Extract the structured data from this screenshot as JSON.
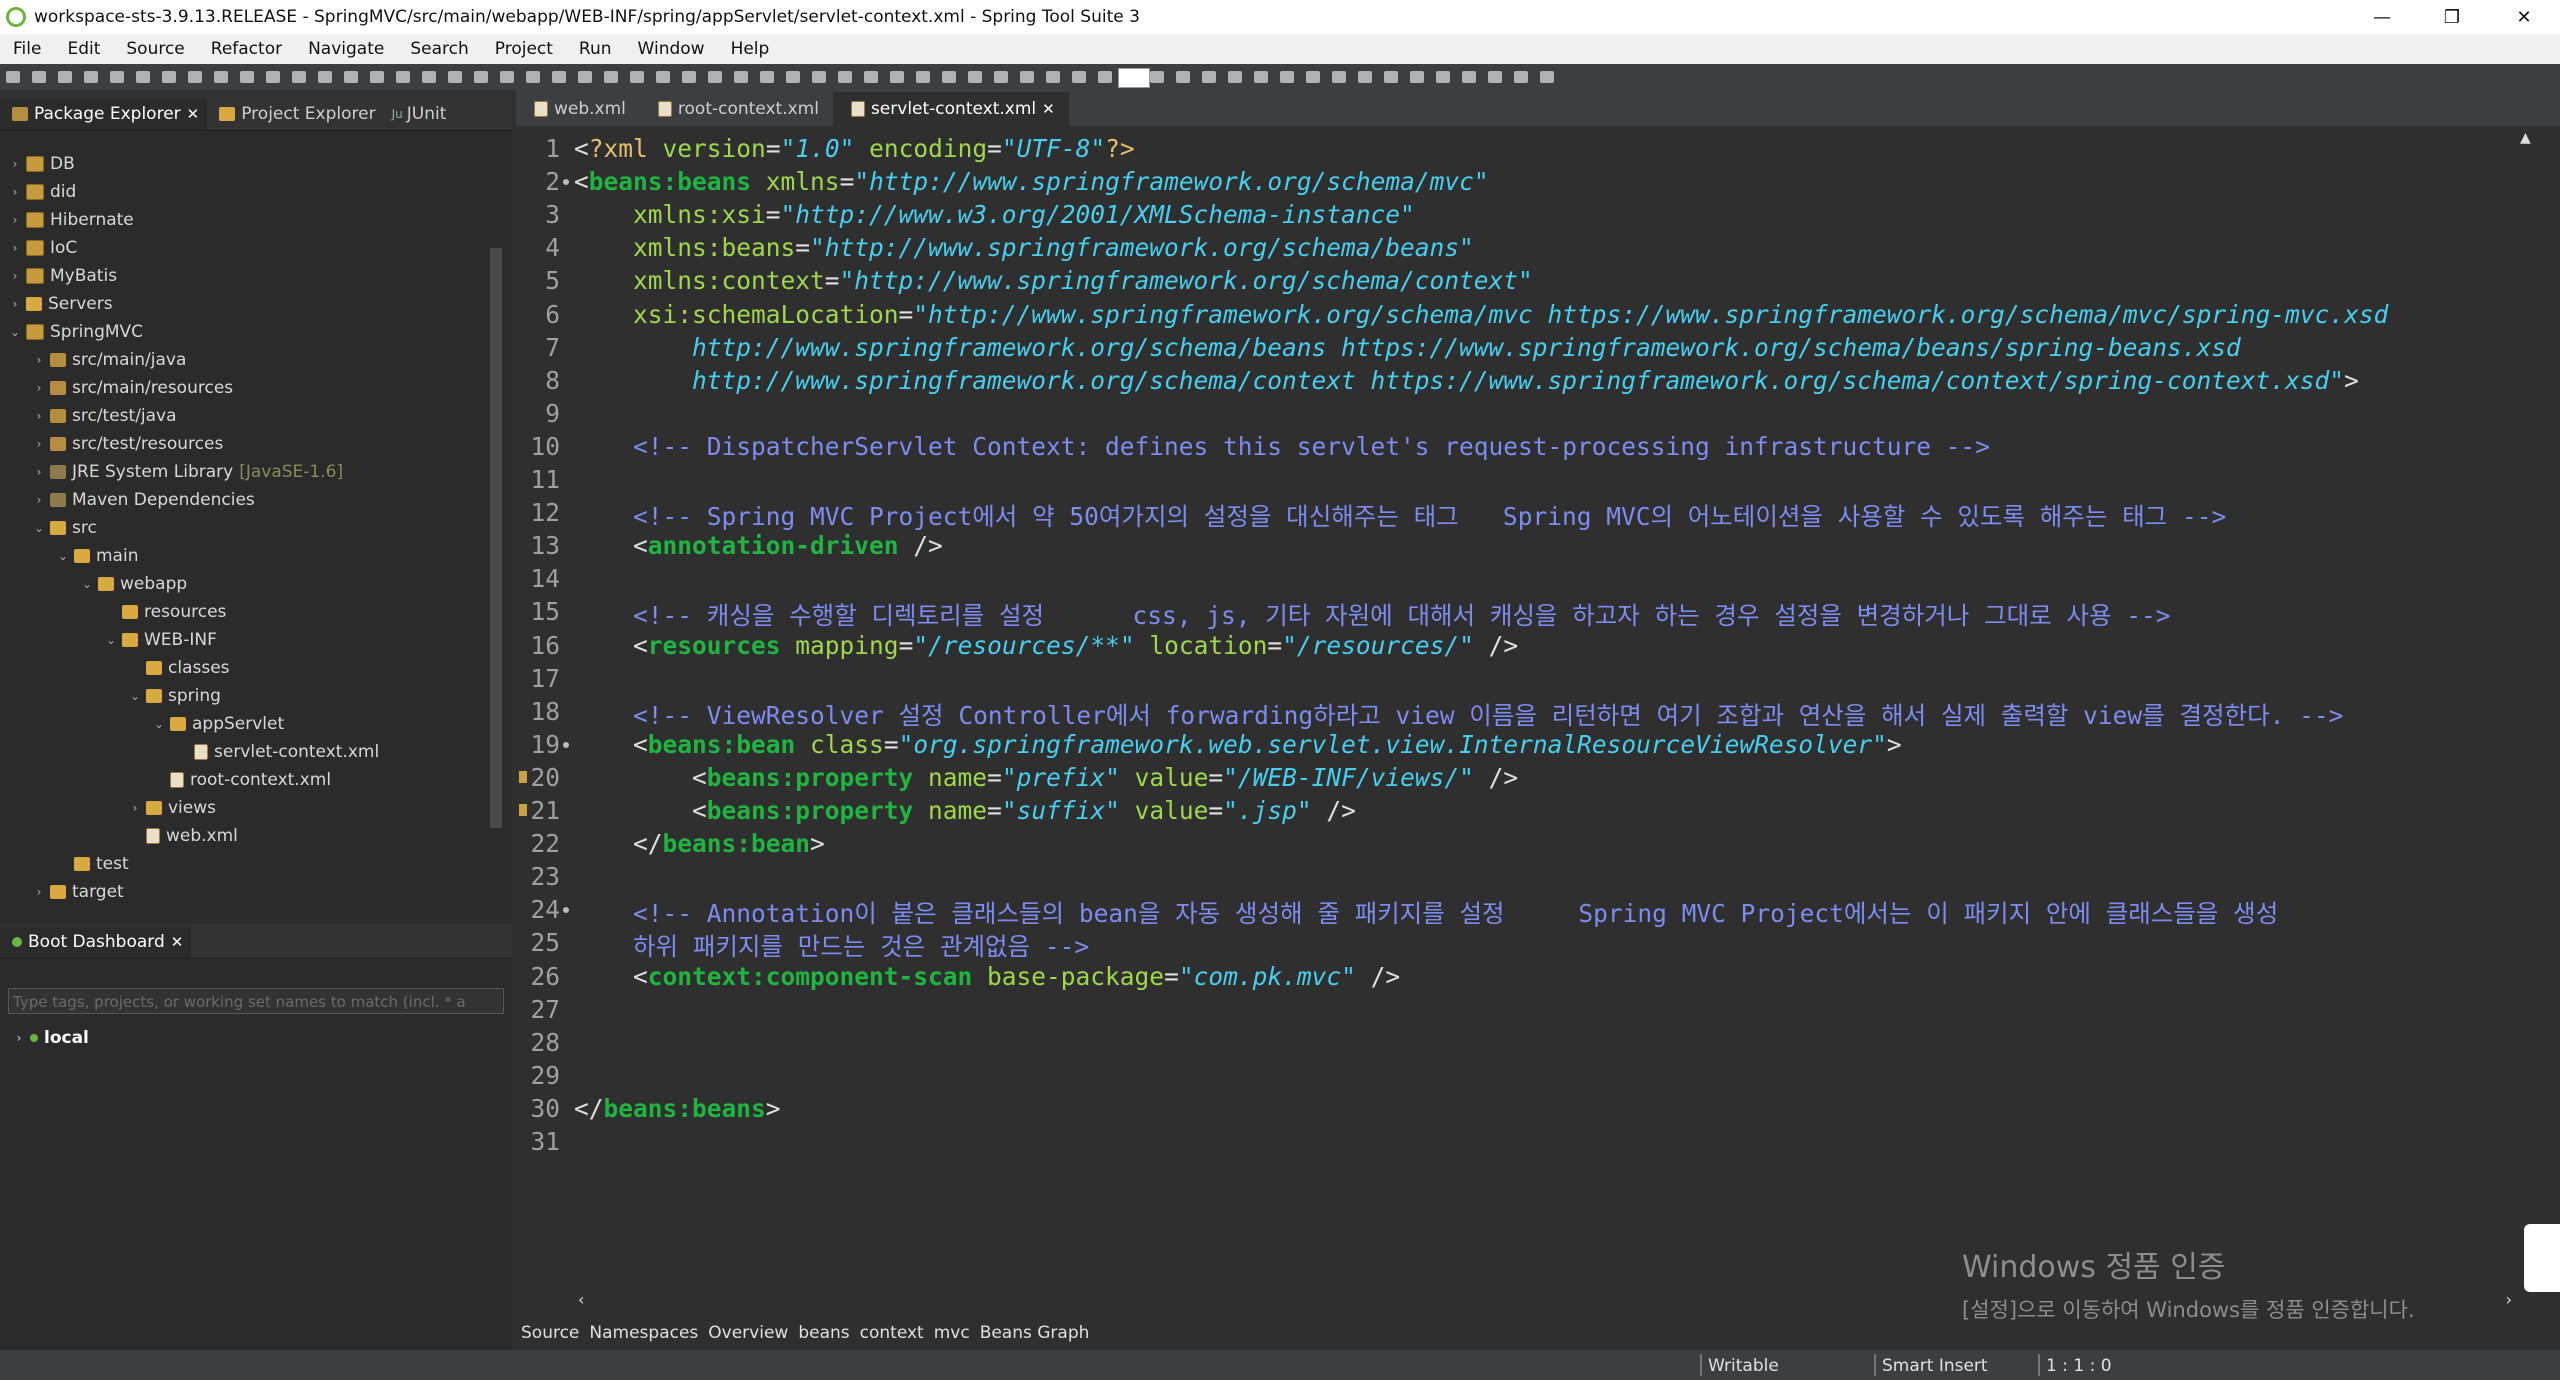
{
  "window": {
    "title": "workspace-sts-3.9.13.RELEASE - SpringMVC/src/main/webapp/WEB-INF/spring/appServlet/servlet-context.xml - Spring Tool Suite 3",
    "minimize": "—",
    "restore": "❐",
    "close": "✕"
  },
  "menu": [
    "File",
    "Edit",
    "Source",
    "Refactor",
    "Navigate",
    "Search",
    "Project",
    "Run",
    "Window",
    "Help"
  ],
  "left_tabs": {
    "package_explorer": "Package Explorer",
    "project_explorer": "Project Explorer",
    "junit": "JUnit"
  },
  "tree": [
    {
      "label": "DB",
      "depth": 0,
      "type": "proj",
      "arrow": "›"
    },
    {
      "label": "did",
      "depth": 0,
      "type": "proj",
      "arrow": "›"
    },
    {
      "label": "Hibernate",
      "depth": 0,
      "type": "proj",
      "arrow": "›"
    },
    {
      "label": "IoC",
      "depth": 0,
      "type": "proj",
      "arrow": "›"
    },
    {
      "label": "MyBatis",
      "depth": 0,
      "type": "proj",
      "arrow": "›"
    },
    {
      "label": "Servers",
      "depth": 0,
      "type": "folder",
      "arrow": "›"
    },
    {
      "label": "SpringMVC",
      "depth": 0,
      "type": "proj",
      "arrow": "⌄"
    },
    {
      "label": "src/main/java",
      "depth": 1,
      "type": "pkg",
      "arrow": "›"
    },
    {
      "label": "src/main/resources",
      "depth": 1,
      "type": "pkg",
      "arrow": "›"
    },
    {
      "label": "src/test/java",
      "depth": 1,
      "type": "pkg",
      "arrow": "›"
    },
    {
      "label": "src/test/resources",
      "depth": 1,
      "type": "pkg",
      "arrow": "›"
    },
    {
      "label": "JRE System Library",
      "extra": "[JavaSE-1.6]",
      "depth": 1,
      "type": "lib",
      "arrow": "›"
    },
    {
      "label": "Maven Dependencies",
      "depth": 1,
      "type": "lib",
      "arrow": "›"
    },
    {
      "label": "src",
      "depth": 1,
      "type": "folder",
      "arrow": "⌄"
    },
    {
      "label": "main",
      "depth": 2,
      "type": "folder",
      "arrow": "⌄"
    },
    {
      "label": "webapp",
      "depth": 3,
      "type": "folder",
      "arrow": "⌄"
    },
    {
      "label": "resources",
      "depth": 4,
      "type": "folder",
      "arrow": ""
    },
    {
      "label": "WEB-INF",
      "depth": 4,
      "type": "folder",
      "arrow": "⌄"
    },
    {
      "label": "classes",
      "depth": 5,
      "type": "folder",
      "arrow": ""
    },
    {
      "label": "spring",
      "depth": 5,
      "type": "folder",
      "arrow": "⌄"
    },
    {
      "label": "appServlet",
      "depth": 6,
      "type": "folder",
      "arrow": "⌄"
    },
    {
      "label": "servlet-context.xml",
      "depth": 7,
      "type": "xml",
      "arrow": ""
    },
    {
      "label": "root-context.xml",
      "depth": 6,
      "type": "xml",
      "arrow": ""
    },
    {
      "label": "views",
      "depth": 5,
      "type": "folder",
      "arrow": "›"
    },
    {
      "label": "web.xml",
      "depth": 5,
      "type": "xml",
      "arrow": ""
    },
    {
      "label": "test",
      "depth": 2,
      "type": "folder",
      "arrow": ""
    },
    {
      "label": "target",
      "depth": 1,
      "type": "folder",
      "arrow": "›"
    }
  ],
  "boot": {
    "title": "Boot Dashboard",
    "filter_placeholder": "Type tags, projects, or working set names to match (incl. * a",
    "local": "local"
  },
  "editor_tabs": [
    {
      "label": "web.xml",
      "active": false
    },
    {
      "label": "root-context.xml",
      "active": false
    },
    {
      "label": "servlet-context.xml",
      "active": true
    }
  ],
  "code": [
    {
      "n": "1",
      "mark": "",
      "segs": [
        [
          "tg",
          "<"
        ],
        [
          "pi",
          "?xml"
        ],
        [
          "tg",
          " "
        ],
        [
          "at",
          "version"
        ],
        [
          "tg",
          "="
        ],
        [
          "av",
          "\"1.0\""
        ],
        [
          "tg",
          " "
        ],
        [
          "at",
          "encoding"
        ],
        [
          "tg",
          "="
        ],
        [
          "av",
          "\"UTF-8\""
        ],
        [
          "pi",
          "?>"
        ]
      ]
    },
    {
      "n": "2",
      "mark": "dot",
      "segs": [
        [
          "tg",
          "<"
        ],
        [
          "el",
          "beans:beans"
        ],
        [
          "tg",
          " "
        ],
        [
          "at",
          "xmlns"
        ],
        [
          "tg",
          "="
        ],
        [
          "av",
          "\"http://www.springframework.org/schema/mvc\""
        ]
      ]
    },
    {
      "n": "3",
      "mark": "",
      "segs": [
        [
          "tg",
          "    "
        ],
        [
          "at",
          "xmlns:xsi"
        ],
        [
          "tg",
          "="
        ],
        [
          "av",
          "\"http://www.w3.org/2001/XMLSchema-instance\""
        ]
      ]
    },
    {
      "n": "4",
      "mark": "",
      "segs": [
        [
          "tg",
          "    "
        ],
        [
          "at",
          "xmlns:beans"
        ],
        [
          "tg",
          "="
        ],
        [
          "av",
          "\"http://www.springframework.org/schema/beans\""
        ]
      ]
    },
    {
      "n": "5",
      "mark": "",
      "segs": [
        [
          "tg",
          "    "
        ],
        [
          "at",
          "xmlns:context"
        ],
        [
          "tg",
          "="
        ],
        [
          "av",
          "\"http://www.springframework.org/schema/context\""
        ]
      ]
    },
    {
      "n": "6",
      "mark": "",
      "segs": [
        [
          "tg",
          "    "
        ],
        [
          "at",
          "xsi:schemaLocation"
        ],
        [
          "tg",
          "="
        ],
        [
          "av",
          "\"http://www.springframework.org/schema/mvc https://www.springframework.org/schema/mvc/spring-mvc.xsd"
        ]
      ]
    },
    {
      "n": "7",
      "mark": "",
      "segs": [
        [
          "av",
          "        http://www.springframework.org/schema/beans https://www.springframework.org/schema/beans/spring-beans.xsd"
        ]
      ]
    },
    {
      "n": "8",
      "mark": "",
      "segs": [
        [
          "av",
          "        http://www.springframework.org/schema/context https://www.springframework.org/schema/context/spring-context.xsd\""
        ],
        [
          "tg",
          ">"
        ]
      ]
    },
    {
      "n": "9",
      "mark": "",
      "segs": []
    },
    {
      "n": "10",
      "mark": "",
      "segs": [
        [
          "cm",
          "    <!-- DispatcherServlet Context: defines this servlet's request-processing infrastructure -->"
        ]
      ]
    },
    {
      "n": "11",
      "mark": "",
      "segs": []
    },
    {
      "n": "12",
      "mark": "",
      "segs": [
        [
          "cm",
          "    <!-- Spring MVC Project에서 약 50여가지의 설정을 대신해주는 태그   Spring MVC의 어노테이션을 사용할 수 있도록 해주는 태그 -->"
        ]
      ]
    },
    {
      "n": "13",
      "mark": "",
      "segs": [
        [
          "tg",
          "    <"
        ],
        [
          "el",
          "annotation-driven"
        ],
        [
          "tg",
          " />"
        ]
      ]
    },
    {
      "n": "14",
      "mark": "",
      "segs": []
    },
    {
      "n": "15",
      "mark": "",
      "segs": [
        [
          "cm",
          "    <!-- 캐싱을 수행할 디렉토리를 설정      css, js, 기타 자원에 대해서 캐싱을 하고자 하는 경우 설정을 변경하거나 그대로 사용 -->"
        ]
      ]
    },
    {
      "n": "16",
      "mark": "",
      "segs": [
        [
          "tg",
          "    <"
        ],
        [
          "el",
          "resources"
        ],
        [
          "tg",
          " "
        ],
        [
          "at",
          "mapping"
        ],
        [
          "tg",
          "="
        ],
        [
          "av",
          "\"/resources/**\""
        ],
        [
          "tg",
          " "
        ],
        [
          "at",
          "location"
        ],
        [
          "tg",
          "="
        ],
        [
          "av",
          "\"/resources/\""
        ],
        [
          "tg",
          " />"
        ]
      ]
    },
    {
      "n": "17",
      "mark": "",
      "segs": []
    },
    {
      "n": "18",
      "mark": "",
      "segs": [
        [
          "cm",
          "    <!-- ViewResolver 설정 Controller에서 forwarding하라고 view 이름을 리턴하면 여기 조합과 연산을 해서 실제 출력할 view를 결정한다. -->"
        ]
      ]
    },
    {
      "n": "19",
      "mark": "dot",
      "segs": [
        [
          "tg",
          "    <"
        ],
        [
          "el",
          "beans:bean"
        ],
        [
          "tg",
          " "
        ],
        [
          "at",
          "class"
        ],
        [
          "tg",
          "="
        ],
        [
          "av",
          "\"org.springframework.web.servlet.view.InternalResourceViewResolver\""
        ],
        [
          "tg",
          ">"
        ]
      ]
    },
    {
      "n": "20",
      "mark": "warn",
      "segs": [
        [
          "tg",
          "        <"
        ],
        [
          "el",
          "beans:property"
        ],
        [
          "tg",
          " "
        ],
        [
          "at",
          "name"
        ],
        [
          "tg",
          "="
        ],
        [
          "av",
          "\"prefix\""
        ],
        [
          "tg",
          " "
        ],
        [
          "at",
          "value"
        ],
        [
          "tg",
          "="
        ],
        [
          "av",
          "\"/WEB-INF/views/\""
        ],
        [
          "tg",
          " />"
        ]
      ]
    },
    {
      "n": "21",
      "mark": "warn",
      "segs": [
        [
          "tg",
          "        <"
        ],
        [
          "el",
          "beans:property"
        ],
        [
          "tg",
          " "
        ],
        [
          "at",
          "name"
        ],
        [
          "tg",
          "="
        ],
        [
          "av",
          "\"suffix\""
        ],
        [
          "tg",
          " "
        ],
        [
          "at",
          "value"
        ],
        [
          "tg",
          "="
        ],
        [
          "av",
          "\".jsp\""
        ],
        [
          "tg",
          " />"
        ]
      ]
    },
    {
      "n": "22",
      "mark": "",
      "segs": [
        [
          "tg",
          "    </"
        ],
        [
          "el",
          "beans:bean"
        ],
        [
          "tg",
          ">"
        ]
      ]
    },
    {
      "n": "23",
      "mark": "",
      "segs": []
    },
    {
      "n": "24",
      "mark": "dot",
      "segs": [
        [
          "cm",
          "    <!-- Annotation이 붙은 클래스들의 bean을 자동 생성해 줄 패키지를 설정     Spring MVC Project에서는 이 패키지 안에 클래스들을 생성"
        ]
      ]
    },
    {
      "n": "25",
      "mark": "",
      "segs": [
        [
          "cm",
          "    하위 패키지를 만드는 것은 관계없음 -->"
        ]
      ]
    },
    {
      "n": "26",
      "mark": "",
      "segs": [
        [
          "tg",
          "    <"
        ],
        [
          "el",
          "context:component-scan"
        ],
        [
          "tg",
          " "
        ],
        [
          "at",
          "base-package"
        ],
        [
          "tg",
          "="
        ],
        [
          "av",
          "\"com.pk.mvc\""
        ],
        [
          "tg",
          " />"
        ]
      ]
    },
    {
      "n": "27",
      "mark": "",
      "segs": []
    },
    {
      "n": "28",
      "mark": "",
      "segs": []
    },
    {
      "n": "29",
      "mark": "",
      "segs": []
    },
    {
      "n": "30",
      "mark": "",
      "segs": [
        [
          "tg",
          "</"
        ],
        [
          "el",
          "beans:beans"
        ],
        [
          "tg",
          ">"
        ]
      ]
    },
    {
      "n": "31",
      "mark": "",
      "segs": []
    }
  ],
  "page_tabs": [
    "Source",
    "Namespaces",
    "Overview",
    "beans",
    "context",
    "mvc",
    "Beans Graph"
  ],
  "status": {
    "writable": "Writable",
    "insert": "Smart Insert",
    "position": "1 : 1 : 0"
  },
  "watermark": {
    "line1": "Windows 정품 인증",
    "line2": "[설정]으로 이동하여 Windows를 정품 인증합니다."
  },
  "colors": {
    "editor_bg": "#2f2f2f",
    "element": "#1eb540",
    "attribute": "#9fd84b",
    "value": "#46cfee",
    "comment": "#7d8cf0"
  }
}
